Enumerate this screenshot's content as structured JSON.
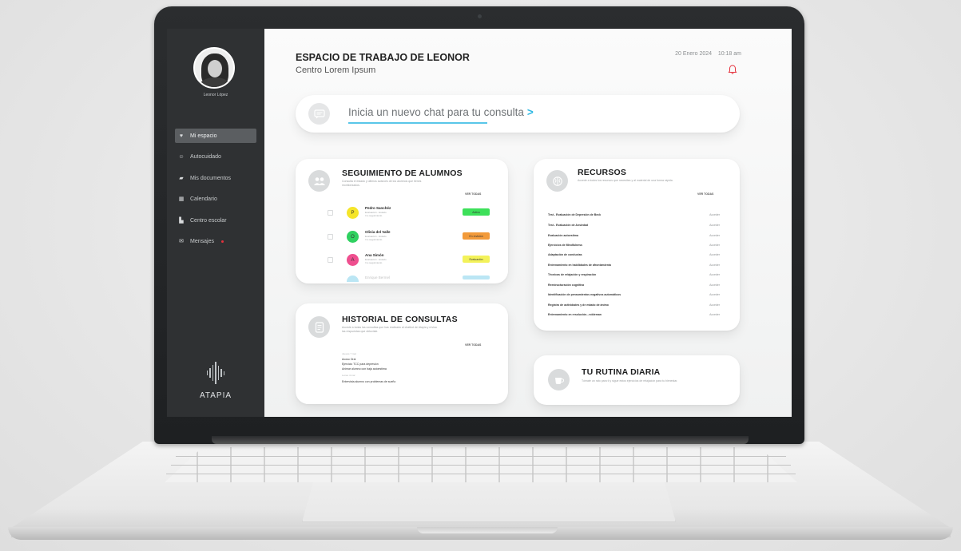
{
  "sidebar": {
    "user_name": "Leonor López",
    "items": [
      {
        "label": "Mi espacio",
        "icon": "heart-icon",
        "active": true
      },
      {
        "label": "Autocuidado",
        "icon": "self-care-icon",
        "active": false
      },
      {
        "label": "Mis documentos",
        "icon": "folder-icon",
        "active": false
      },
      {
        "label": "Calendario",
        "icon": "calendar-icon",
        "active": false
      },
      {
        "label": "Centro escolar",
        "icon": "building-icon",
        "active": false
      },
      {
        "label": "Mensajes",
        "icon": "mail-icon",
        "active": false,
        "notification": true
      }
    ],
    "brand": "ATAPIA"
  },
  "header": {
    "title": "ESPACIO DE TRABAJO DE LEONOR",
    "subtitle": "Centro Lorem Ipsum",
    "date": "20 Enero 2024",
    "time": "10:18 am"
  },
  "chat": {
    "prompt": "Inicia un nuevo chat para tu consulta",
    "arrow": ">"
  },
  "alumnos": {
    "title": "SEGUIMIENTO DE ALUMNOS",
    "description": "Consulta el estado y últimos avances de los alumnos que tienes monitorizados.",
    "see_all": "VER TODAS",
    "students": [
      {
        "initial": "P",
        "name": "Pedro Sanchéz",
        "meta1": "Evaluación - Estado",
        "meta2": "Ir a seguimiento",
        "badge": "Activo",
        "avatar_color": "#f5e52a",
        "badge_color": "#3de05a"
      },
      {
        "initial": "O",
        "name": "Olivia del Valle",
        "meta1": "Evaluación - Estado",
        "meta2": "Ir a seguimiento",
        "badge": "En revisión",
        "avatar_color": "#2fd160",
        "badge_color": "#f29a3a"
      },
      {
        "initial": "A",
        "name": "Ana Simón",
        "meta1": "Evaluación - Estado",
        "meta2": "Ir a seguimiento",
        "badge": "Evaluación",
        "avatar_color": "#ef4f8f",
        "badge_color": "#f3f25a"
      },
      {
        "initial": "",
        "name": "Enrique Bermel",
        "meta1": "",
        "meta2": "",
        "badge": "",
        "avatar_color": "#8fd6ee",
        "badge_color": "#8fd6ee"
      }
    ]
  },
  "historial": {
    "title": "HISTORIAL DE CONSULTAS",
    "description": "Accede a todas las consultas que has realizado al chatbot de Atapia y revisa las respuestas que obtuviste.",
    "see_all": "VER TODAS",
    "entries": [
      {
        "date": "Jueves 7 mar",
        "lines": [
          "Acoso Oral",
          "Ejercicio TCC para depresión",
          "Animar alumno con baja autoestima"
        ]
      },
      {
        "date": "Lunes 4 mar",
        "lines": [
          "Entrevista alumno con problemas de sueño"
        ]
      }
    ]
  },
  "recursos": {
    "title": "RECURSOS",
    "description": "Accede a todos los recursos que necesites y al material de una forma rápida.",
    "see_all": "VER TODAS",
    "items": [
      {
        "label": "Test - Evaluación de Depresión de Beck",
        "action": "Acceder"
      },
      {
        "label": "Test - Evaluación de Ansiedad",
        "action": "Acceder"
      },
      {
        "label": "Evaluación autoestima",
        "action": "Acceder"
      },
      {
        "label": "Ejercicios de Mindfulness",
        "action": "Acceder"
      },
      {
        "label": "Adaptación de conductas",
        "action": "Acceder"
      },
      {
        "label": "Entrenamiento en habilidades de afrontamiento",
        "action": "Acceder"
      },
      {
        "label": "Técnicas de relajación y respiración",
        "action": "Acceder"
      },
      {
        "label": "Reestructuración cognitiva",
        "action": "Acceder"
      },
      {
        "label": "Identificación de pensamientos negativos automáticos",
        "action": "Acceder"
      },
      {
        "label": "Registro de actividades y de estado de ánimo",
        "action": "Acceder"
      },
      {
        "label": "Entrenamiento en resolución...robleman",
        "action": "Acceder"
      }
    ]
  },
  "rutina": {
    "title": "TU RUTINA DIARIA",
    "description": "Tómate un rato para ti y sigue estos ejercicios de relajación para tu bienestar."
  },
  "colors": {
    "sidebar_bg": "#2f3133",
    "accent": "#2fb8e3",
    "notification": "#e5313c"
  }
}
